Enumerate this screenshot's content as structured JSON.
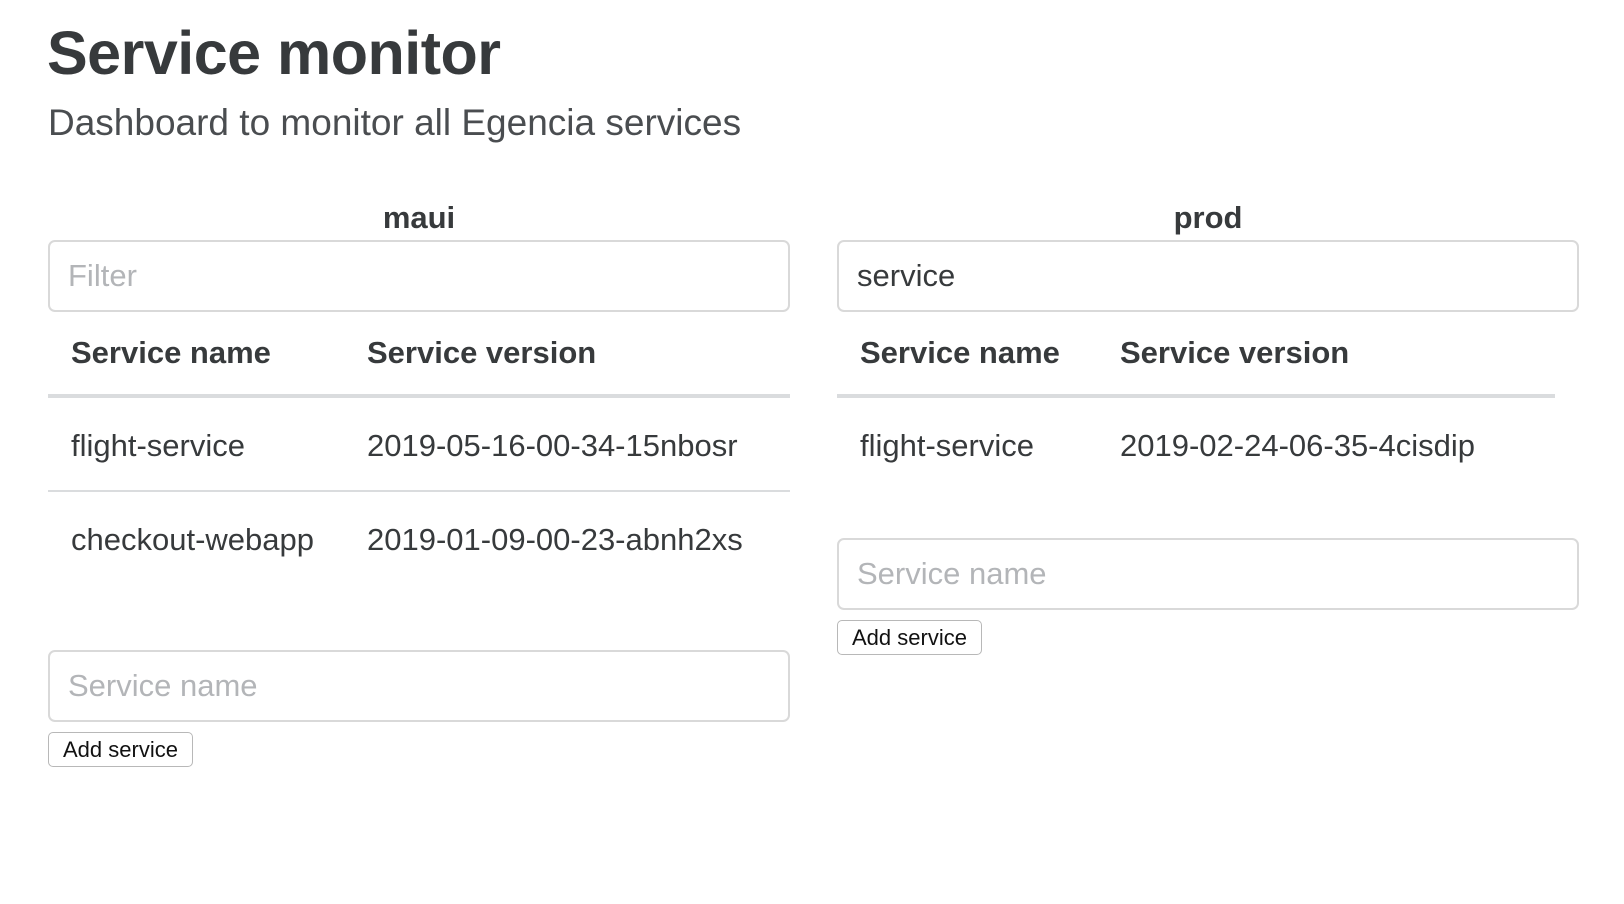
{
  "header": {
    "title": "Service monitor",
    "subtitle": "Dashboard to monitor all Egencia services"
  },
  "environments": [
    {
      "name": "maui",
      "filter": {
        "value": "",
        "placeholder": "Filter"
      },
      "columns": [
        "Service name",
        "Service version"
      ],
      "rows": [
        {
          "name": "flight-service",
          "version": "2019-05-16-00-34-15nbosr"
        },
        {
          "name": "checkout-webapp",
          "version": "2019-01-09-00-23-abnh2xs"
        }
      ],
      "add_input": {
        "value": "",
        "placeholder": "Service name"
      },
      "add_button_label": "Add service"
    },
    {
      "name": "prod",
      "filter": {
        "value": "service",
        "placeholder": "Filter"
      },
      "columns": [
        "Service name",
        "Service version"
      ],
      "rows": [
        {
          "name": "flight-service",
          "version": "2019-02-24-06-35-4cisdip"
        }
      ],
      "add_input": {
        "value": "",
        "placeholder": "Service name"
      },
      "add_button_label": "Add service"
    }
  ]
}
